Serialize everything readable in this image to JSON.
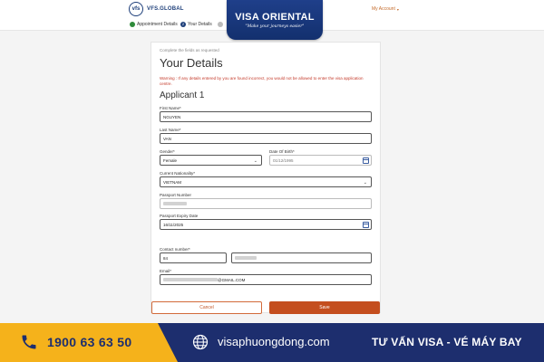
{
  "header": {
    "logo_text": "VFS.GLOBAL",
    "logo_mark": "vfs",
    "account_label": "My Account",
    "account_caret": "▾"
  },
  "steps": [
    {
      "label": "Appointment Details",
      "status": "complete"
    },
    {
      "label": "Your Details",
      "status": "current",
      "number": "2"
    },
    {
      "label": "",
      "status": "pending"
    }
  ],
  "brand": {
    "title": "VISA ORIENTAL",
    "slogan": "\"Make your journeys easier\""
  },
  "form": {
    "hint": "Complete the fields as requested",
    "title": "Your Details",
    "warning": "Warning : If any details entered by you are found incorrect, you would not be allowed to enter the visa application centre.",
    "applicant": "Applicant 1",
    "fields": {
      "first_name": {
        "label": "First Name*",
        "value": "NGUYEN"
      },
      "last_name": {
        "label": "Last Name*",
        "value": "VAN"
      },
      "gender": {
        "label": "Gender*",
        "value": "Female"
      },
      "dob": {
        "label": "Date Of Birth*",
        "value": "01/12/1995"
      },
      "nationality": {
        "label": "Current Nationality*",
        "value": "VIETNAM"
      },
      "passport_number": {
        "label": "Passport Number",
        "value": ""
      },
      "passport_expiry": {
        "label": "Passport Expiry Date",
        "value": "16/11/2025"
      },
      "contact_number": {
        "label": "Contact number*",
        "code": "84",
        "value": ""
      },
      "email": {
        "label": "Email*",
        "value": "@GMAIL.COM"
      }
    },
    "cancel_label": "Cancel",
    "save_label": "Save"
  },
  "footer": {
    "phone": "1900 63 63 50",
    "website": "visaphuongdong.com",
    "tagline": "TƯ VẤN VISA - VÉ MÁY BAY"
  },
  "colors": {
    "brand_navy": "#1d2e6e",
    "accent_orange": "#c44e1e",
    "footer_yellow": "#f5b21b",
    "warning_red": "#c43a2a"
  }
}
